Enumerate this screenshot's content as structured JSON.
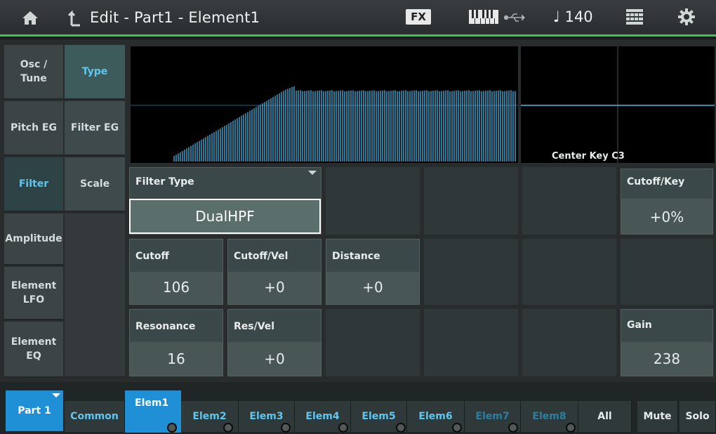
{
  "header": {
    "title": "Edit - Part1 - Element1",
    "fx_label": "FX",
    "tempo": "♩ 140",
    "icons": [
      "home-icon",
      "up-arrow-icon",
      "keyboard-icon",
      "usb-icon",
      "grid-icon",
      "gear-icon"
    ]
  },
  "left_tabs": [
    {
      "label": "Osc /\nTune"
    },
    {
      "label": "Pitch EG"
    },
    {
      "label": "Filter"
    },
    {
      "label": "Amplitude"
    },
    {
      "label": "Element\nLFO"
    },
    {
      "label": "Element\nEQ"
    }
  ],
  "sub_tabs": [
    {
      "label": "Type"
    },
    {
      "label": "Filter EG"
    },
    {
      "label": "Scale"
    }
  ],
  "graph": {
    "center_key_label": "Center Key C3"
  },
  "params": {
    "filter_type_label": "Filter Type",
    "filter_type_value": "DualHPF",
    "cutoff_key_label": "Cutoff/Key",
    "cutoff_key_value": "+0%",
    "cutoff_label": "Cutoff",
    "cutoff_value": "106",
    "cutoff_vel_label": "Cutoff/Vel",
    "cutoff_vel_value": "+0",
    "distance_label": "Distance",
    "distance_value": "+0",
    "resonance_label": "Resonance",
    "resonance_value": "16",
    "res_vel_label": "Res/Vel",
    "res_vel_value": "+0",
    "gain_label": "Gain",
    "gain_value": "238"
  },
  "bottom": {
    "part_label": "Part 1",
    "common_label": "Common",
    "elements": [
      "Elem1",
      "Elem2",
      "Elem3",
      "Elem4",
      "Elem5",
      "Elem6",
      "Elem7",
      "Elem8"
    ],
    "all_label": "All",
    "mute_label": "Mute",
    "solo_label": "Solo"
  },
  "colors": {
    "accent": "#5fc6ee",
    "selected_blue": "#1f8fd6",
    "header_green": "#37c94a",
    "graph_line": "#4fb7e8"
  }
}
